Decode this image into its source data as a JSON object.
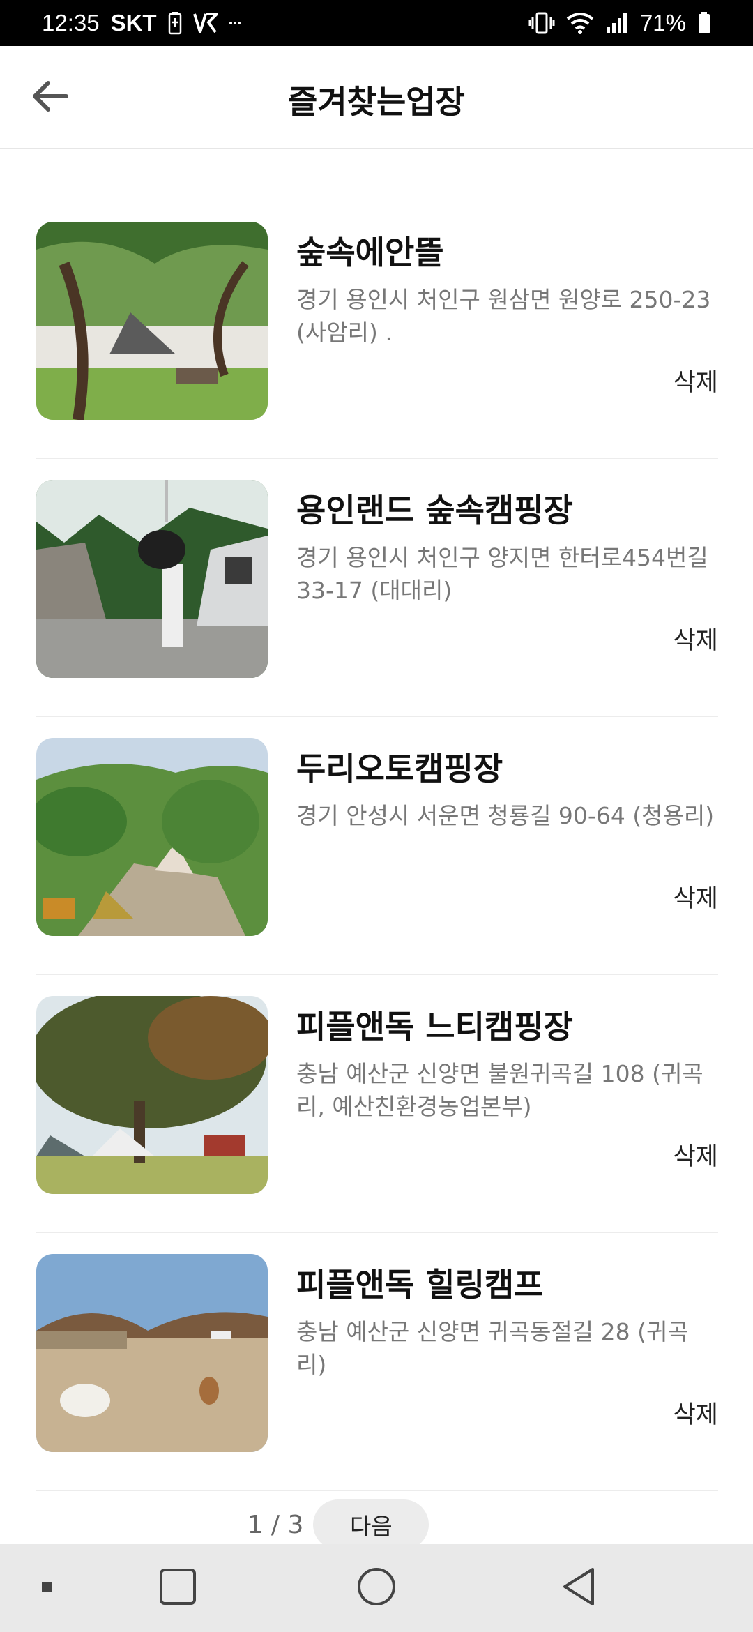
{
  "status_bar": {
    "time": "12:35",
    "carrier": "SKT",
    "battery_percent": "71%",
    "icons": [
      "battery-charging-icon",
      "v3-app-icon",
      "more-notifications-icon",
      "vibrate-icon",
      "wifi-icon",
      "signal-icon",
      "battery-icon"
    ]
  },
  "header": {
    "title": "즐겨찾는업장",
    "back_icon": "back-arrow-icon"
  },
  "favorites": [
    {
      "name": "숲속에안뜰",
      "address": "경기 용인시 처인구 원삼면 원양로 250-23 (사암리) .",
      "delete_label": "삭제"
    },
    {
      "name": "용인랜드 숲속캠핑장",
      "address": "경기 용인시 처인구 양지면 한터로454번길 33-17 (대대리)",
      "delete_label": "삭제"
    },
    {
      "name": "두리오토캠핑장",
      "address": "경기 안성시 서운면 청룡길 90-64 (청용리)",
      "delete_label": "삭제"
    },
    {
      "name": "피플앤독 느티캠핑장",
      "address": "충남 예산군 신양면 불원귀곡길 108 (귀곡리, 예산친환경농업본부)",
      "delete_label": "삭제"
    },
    {
      "name": "피플앤독 힐링캠프",
      "address": "충남 예산군 신양면 귀곡동절길 28 (귀곡리)",
      "delete_label": "삭제"
    }
  ],
  "pagination": {
    "indicator": "1 / 3",
    "next_label": "다음"
  },
  "nav_bar": {
    "icons": [
      "menu-dot-icon",
      "recent-apps-icon",
      "home-icon",
      "back-icon"
    ]
  }
}
